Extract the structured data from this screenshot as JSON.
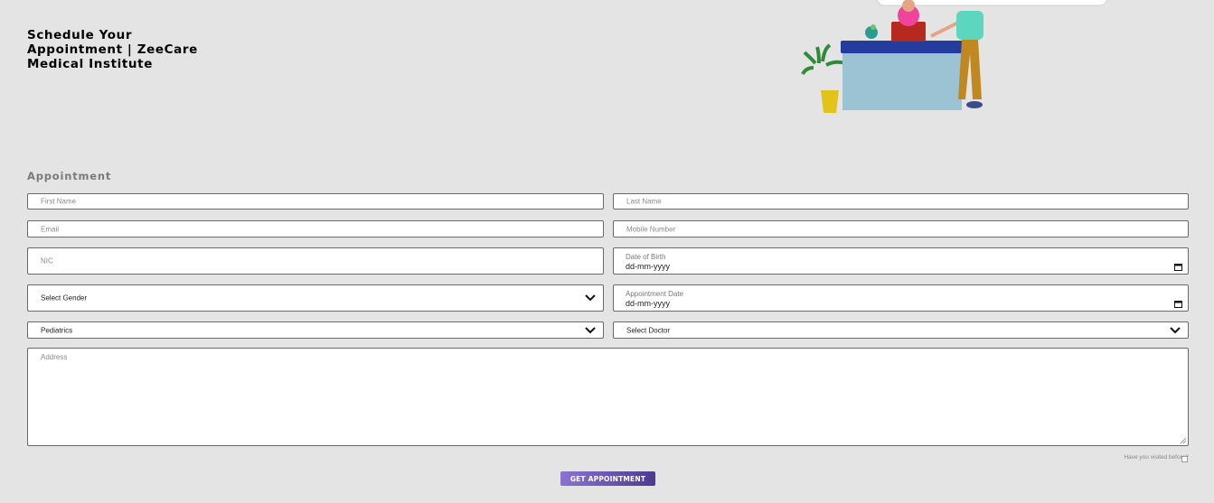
{
  "hero": {
    "title": "Schedule Your Appointment | ZeeCare Medical Institute"
  },
  "illustration": {
    "icon": "reception-desk-illustration"
  },
  "form": {
    "heading": "Appointment",
    "first_name": {
      "placeholder": "First Name",
      "value": ""
    },
    "last_name": {
      "placeholder": "Last Name",
      "value": ""
    },
    "email": {
      "placeholder": "Email",
      "value": ""
    },
    "mobile": {
      "placeholder": "Mobile Number",
      "value": ""
    },
    "nic": {
      "placeholder": "NIC",
      "value": ""
    },
    "dob": {
      "label": "Date of Birth",
      "value": "dd-mm-yyyy"
    },
    "gender": {
      "selected": "Select Gender"
    },
    "appointment_date": {
      "label": "Appointment Date",
      "value": "dd-mm-yyyy"
    },
    "department": {
      "selected": "Pediatrics"
    },
    "doctor": {
      "selected": "Select Doctor"
    },
    "address": {
      "placeholder": "Address",
      "value": ""
    },
    "visited_label": "Have you visited before?",
    "visited_checked": false,
    "submit_label": "GET APPOINTMENT"
  },
  "colors": {
    "background": "#e4e4e4",
    "button_start": "#8a74d0",
    "button_end": "#4b3b8f"
  }
}
